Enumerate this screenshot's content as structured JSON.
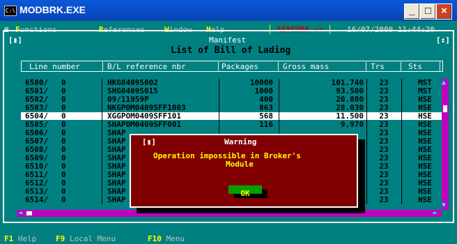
{
  "window": {
    "title": "MODBRK.EXE",
    "icon_text": "C:\\",
    "minimize_glyph": "_",
    "maximize_glyph": "□",
    "close_glyph": "×"
  },
  "menubar": {
    "system_glyph": "≡",
    "items": [
      {
        "hotkey": "F",
        "rest": "unctions"
      },
      {
        "hotkey": "R",
        "rest": "eferences"
      },
      {
        "hotkey": "W",
        "rest": "indow"
      },
      {
        "hotkey": "H",
        "rest": "elp"
      }
    ],
    "app_name": "ASYCUDA ++",
    "date": "16/07/2009",
    "time": "11:44:20"
  },
  "frame": {
    "left_marker": "[▮]",
    "right_marker": "[↕]",
    "window_title": "Manifest",
    "subtitle": "List of Bill of Lading"
  },
  "table": {
    "columns": [
      "Line number",
      "B/L reference nbr",
      "Packages",
      "Gross mass",
      "Trs",
      "Sts"
    ],
    "rows": [
      {
        "line": "6500/",
        "sub": "0",
        "bl": "HKG0409S002",
        "pkg": "10000",
        "mass": "101.740",
        "trs": "23",
        "sts": "MST"
      },
      {
        "line": "6501/",
        "sub": "0",
        "bl": "SHG0409S015",
        "pkg": "1000",
        "mass": "93.500",
        "trs": "23",
        "sts": "MST"
      },
      {
        "line": "6502/",
        "sub": "0",
        "bl": "09/11959P",
        "pkg": "400",
        "mass": "20.080",
        "trs": "23",
        "sts": "HSE"
      },
      {
        "line": "6503/",
        "sub": "0",
        "bl": "NKGPOM0409SFF1003",
        "pkg": "863",
        "mass": "28.030",
        "trs": "23",
        "sts": "HSE"
      },
      {
        "line": "6504/",
        "sub": "0",
        "bl": "XGGPOM0409SFF101",
        "pkg": "568",
        "mass": "11.500",
        "trs": "23",
        "sts": "HSE",
        "selected": true
      },
      {
        "line": "6505/",
        "sub": "0",
        "bl": "SHAPOM0409SFF001",
        "pkg": "116",
        "mass": "9.970",
        "trs": "23",
        "sts": "HSE"
      },
      {
        "line": "6506/",
        "sub": "0",
        "bl": "SHAP",
        "pkg": "",
        "mass": "",
        "trs": "23",
        "sts": "HSE"
      },
      {
        "line": "6507/",
        "sub": "0",
        "bl": "SHAP",
        "pkg": "",
        "mass": "",
        "trs": "23",
        "sts": "HSE"
      },
      {
        "line": "6508/",
        "sub": "0",
        "bl": "SHAP",
        "pkg": "",
        "mass": "",
        "trs": "23",
        "sts": "HSE"
      },
      {
        "line": "6509/",
        "sub": "0",
        "bl": "SHAP",
        "pkg": "",
        "mass": "",
        "trs": "23",
        "sts": "HSE"
      },
      {
        "line": "6510/",
        "sub": "0",
        "bl": "SHAP",
        "pkg": "",
        "mass": "",
        "trs": "23",
        "sts": "HSE"
      },
      {
        "line": "6511/",
        "sub": "0",
        "bl": "SHAP",
        "pkg": "",
        "mass": "",
        "trs": "23",
        "sts": "HSE"
      },
      {
        "line": "6512/",
        "sub": "0",
        "bl": "SHAP",
        "pkg": "",
        "mass": "",
        "trs": "23",
        "sts": "HSE"
      },
      {
        "line": "6513/",
        "sub": "0",
        "bl": "SHAP",
        "pkg": "",
        "mass": "",
        "trs": "23",
        "sts": "HSE"
      },
      {
        "line": "6514/",
        "sub": "0",
        "bl": "SHAP",
        "pkg": "",
        "mass": "",
        "trs": "23",
        "sts": "HSE"
      }
    ]
  },
  "dialog": {
    "marker": "[▮]",
    "title": "Warning",
    "message_line1": "Operation impossible in Broker's",
    "message_line2": "Module",
    "ok_label": "OK"
  },
  "statusbar": {
    "items": [
      {
        "key": "F1",
        "label": "Help"
      },
      {
        "key": "F9",
        "label": "Local Menu"
      },
      {
        "key": "F10",
        "label": "Menu"
      }
    ]
  },
  "colors": {
    "console_bg": "#008080",
    "dialog_bg": "#800000",
    "hotkey": "#ffff00",
    "menu_text": "#c0c0c0",
    "scrollbar": "#c000c0",
    "ok_button": "#00a000"
  }
}
